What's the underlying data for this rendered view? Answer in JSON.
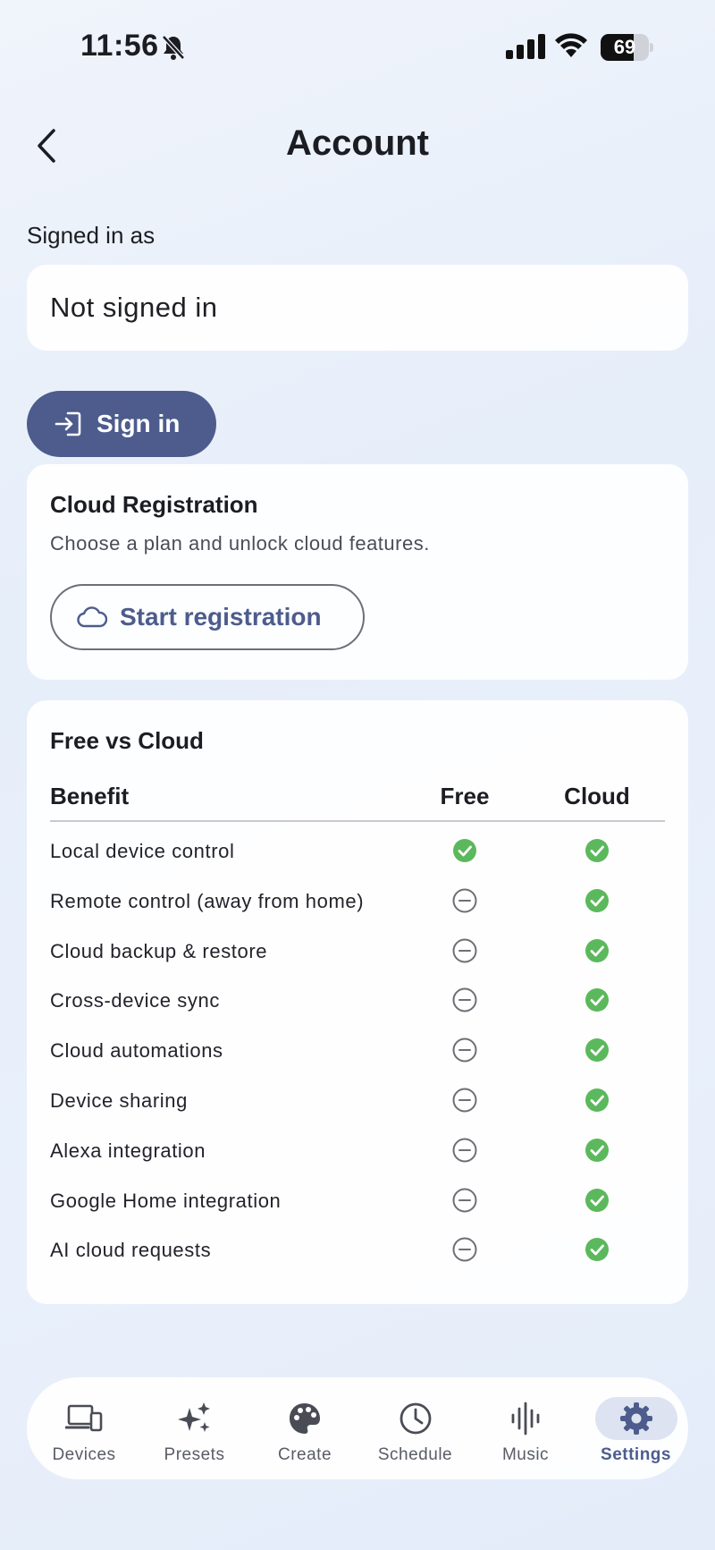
{
  "status_bar": {
    "time": "11:56",
    "battery": "69",
    "battery_level": 0.69
  },
  "header": {
    "title": "Account"
  },
  "account": {
    "signed_in_label": "Signed in as",
    "signed_in_value": "Not signed in",
    "sign_in_button": "Sign in"
  },
  "registration": {
    "title": "Cloud Registration",
    "subtitle": "Choose a plan and unlock cloud features.",
    "button": "Start registration"
  },
  "comparison": {
    "title": "Free vs Cloud",
    "columns": [
      "Benefit",
      "Free",
      "Cloud"
    ],
    "rows": [
      {
        "benefit": "Local device control",
        "free": true,
        "cloud": true
      },
      {
        "benefit": "Remote control (away from home)",
        "free": false,
        "cloud": true
      },
      {
        "benefit": "Cloud backup & restore",
        "free": false,
        "cloud": true
      },
      {
        "benefit": "Cross-device sync",
        "free": false,
        "cloud": true
      },
      {
        "benefit": "Cloud automations",
        "free": false,
        "cloud": true
      },
      {
        "benefit": "Device sharing",
        "free": false,
        "cloud": true
      },
      {
        "benefit": "Alexa integration",
        "free": false,
        "cloud": true
      },
      {
        "benefit": "Google Home integration",
        "free": false,
        "cloud": true
      },
      {
        "benefit": "AI cloud requests",
        "free": false,
        "cloud": true
      }
    ]
  },
  "nav": {
    "items": [
      {
        "label": "Devices",
        "icon": "devices-icon",
        "active": false
      },
      {
        "label": "Presets",
        "icon": "sparkle-icon",
        "active": false
      },
      {
        "label": "Create",
        "icon": "palette-icon",
        "active": false
      },
      {
        "label": "Schedule",
        "icon": "clock-icon",
        "active": false
      },
      {
        "label": "Music",
        "icon": "waveform-icon",
        "active": false
      },
      {
        "label": "Settings",
        "icon": "gear-icon",
        "active": true
      }
    ]
  },
  "colors": {
    "accent": "#4d5c8d",
    "check_green": "#5cb85c",
    "muted_icon": "#6e6f76"
  }
}
